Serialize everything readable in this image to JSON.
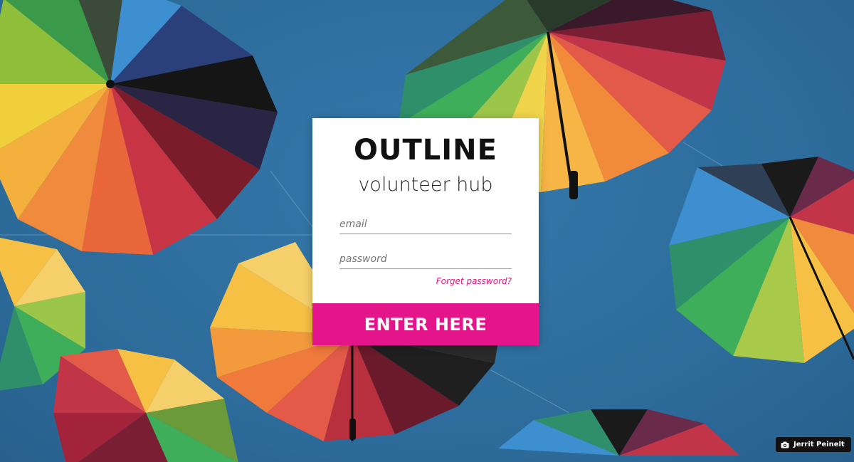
{
  "brand": {
    "title": "OUTLINE",
    "subtitle": "volunteer hub"
  },
  "login": {
    "email_placeholder": "email",
    "password_placeholder": "password",
    "forgot_label": "Forget password?",
    "submit_label": "ENTER HERE"
  },
  "photo_credit": {
    "icon": "camera-icon",
    "name": "Jerrit Peinelt"
  },
  "colors": {
    "accent": "#e4148a",
    "link": "#e0157f",
    "sky": "#2f6f9f",
    "card": "#ffffff"
  }
}
